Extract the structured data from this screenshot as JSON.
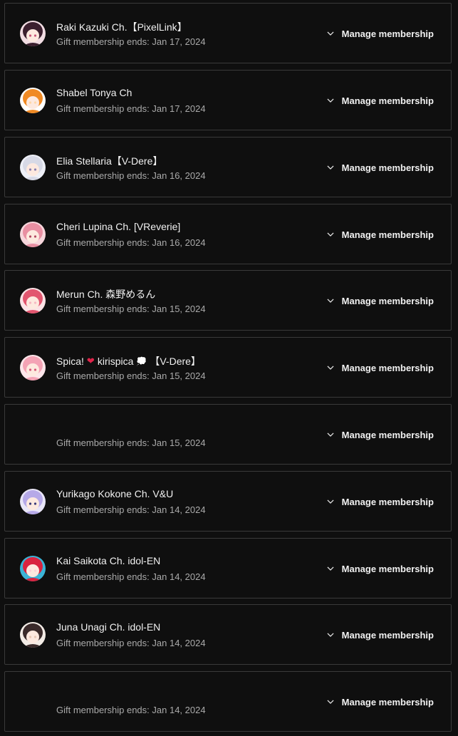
{
  "memberships": [
    {
      "channel": "Raki Kazuki Ch.【PixelLink】",
      "ends": "Gift membership ends: Jan 17, 2024",
      "avatar": {
        "bg": "#f2dde3",
        "hair": "#3b1f2e",
        "accent": "#c9587b"
      }
    },
    {
      "channel": "Shabel Tonya Ch",
      "ends": "Gift membership ends: Jan 17, 2024",
      "avatar": {
        "bg": "#ffffff",
        "hair": "#f08a24",
        "accent": "#ffd7a8"
      }
    },
    {
      "channel": "Elia Stellaria【V-Dere】",
      "ends": "Gift membership ends: Jan 16, 2024",
      "avatar": {
        "bg": "#eef0f7",
        "hair": "#d7d9e6",
        "accent": "#8a7fb0"
      }
    },
    {
      "channel": "Cheri Lupina Ch. [VReverie]",
      "ends": "Gift membership ends: Jan 16, 2024",
      "avatar": {
        "bg": "#f7d6dc",
        "hair": "#e88fa2",
        "accent": "#b44a63"
      }
    },
    {
      "channel": "Merun Ch. 森野めるん",
      "ends": "Gift membership ends: Jan 15, 2024",
      "avatar": {
        "bg": "#fbe3e6",
        "hair": "#e2566f",
        "accent": "#f7b7c2"
      }
    },
    {
      "channel": "Spica! ❤️ kirispica 💭 【V-Dere】",
      "channel_parts": [
        "Spica!",
        "❤",
        "kirispica",
        "💭",
        "【V-Dere】"
      ],
      "ends": "Gift membership ends: Jan 15, 2024",
      "avatar": {
        "bg": "#fde6ea",
        "hair": "#f4a3b5",
        "accent": "#d6587a"
      }
    },
    {
      "channel": "",
      "ends": "Gift membership ends: Jan 15, 2024",
      "avatar": null
    },
    {
      "channel": "Yurikago Kokone Ch. V&U",
      "ends": "Gift membership ends: Jan 14, 2024",
      "avatar": {
        "bg": "#e9e6f7",
        "hair": "#b6a9e8",
        "accent": "#3a3a7a"
      }
    },
    {
      "channel": "Kai Saikota Ch. idol-EN",
      "ends": "Gift membership ends: Jan 14, 2024",
      "avatar": {
        "bg": "#3bb3d6",
        "hair": "#d9233f",
        "accent": "#ffd1d8"
      }
    },
    {
      "channel": "Juna Unagi Ch. idol-EN",
      "ends": "Gift membership ends: Jan 14, 2024",
      "avatar": {
        "bg": "#f3ece6",
        "hair": "#3a2a2a",
        "accent": "#e8c7b4"
      }
    },
    {
      "channel": "",
      "ends": "Gift membership ends: Jan 14, 2024",
      "avatar": null
    }
  ],
  "manage_label": "Manage membership",
  "chevron_icon": "chevron-down-icon"
}
